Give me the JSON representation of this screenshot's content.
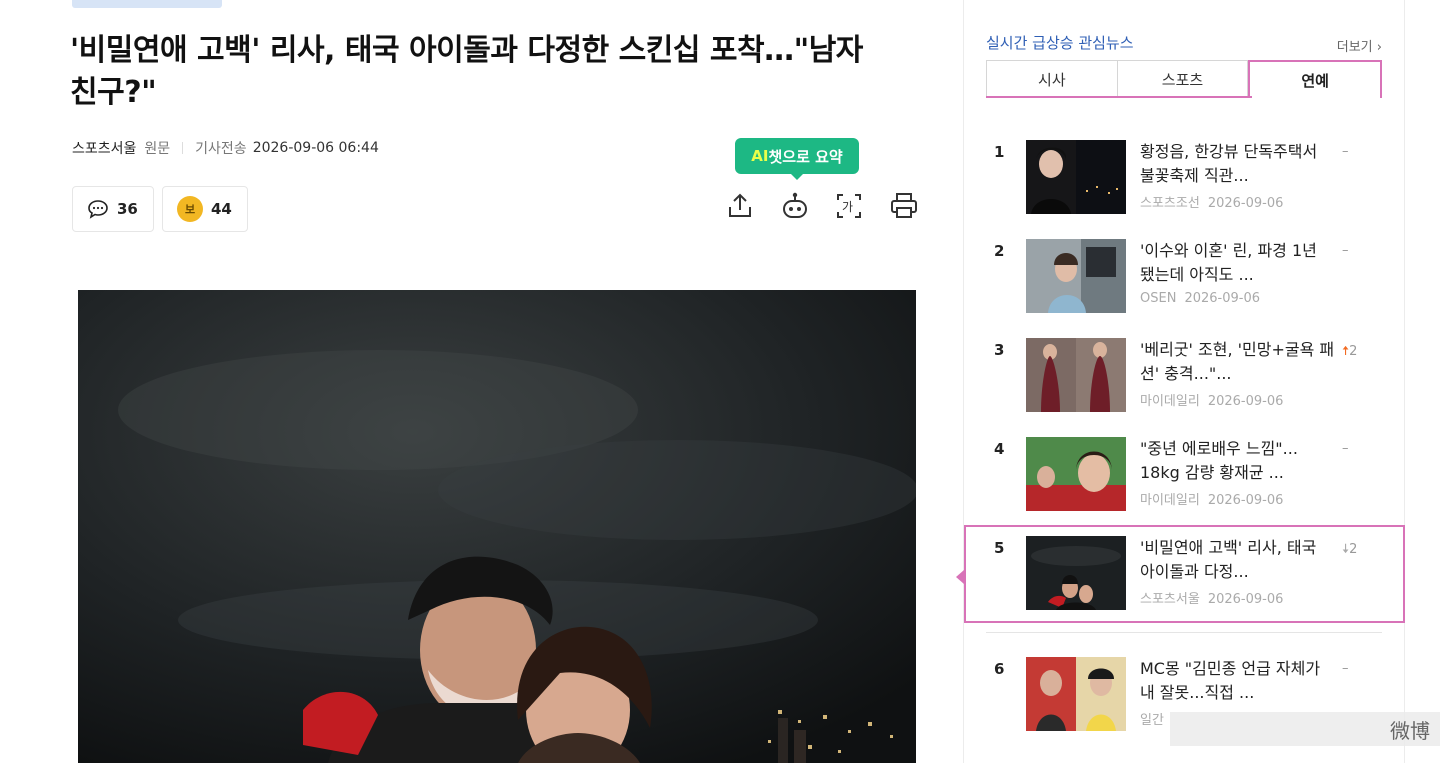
{
  "article": {
    "headline": "'비밀연애 고백' 리사, 태국 아이돌과 다정한 스킨십 포착…\"남자친구?\"",
    "source": "스포츠서울",
    "original_label": "원문",
    "sent_label": "기사전송",
    "datetime": "2026-09-06 06:44",
    "comment_count": "36",
    "reaction_count": "44",
    "reaction_badge": "보",
    "ai_tooltip_prefix": "AI",
    "ai_tooltip_suffix": "챗으로 요약",
    "font_button": "가"
  },
  "sidebar": {
    "title": "실시간 급상승 관심뉴스",
    "more": "더보기",
    "tabs": [
      {
        "label": "시사",
        "active": false
      },
      {
        "label": "스포츠",
        "active": false
      },
      {
        "label": "연예",
        "active": true
      }
    ],
    "items": [
      {
        "rank": "1",
        "title": "황정음, 한강뷰 단독주택서 불꽃축제 직관...",
        "source": "스포츠조선",
        "date": "2026-09-06",
        "change": "–"
      },
      {
        "rank": "2",
        "title": "'이수와 이혼' 린, 파경 1년 됐는데 아직도 ...",
        "source": "OSEN",
        "date": "2026-09-06",
        "change": "–"
      },
      {
        "rank": "3",
        "title": "'베리굿' 조현, '민망+굴욕 패션' 충격...\"...",
        "source": "마이데일리",
        "date": "2026-09-06",
        "change": "2",
        "direction": "up"
      },
      {
        "rank": "4",
        "title": "\"중년 에로배우 느낌\"... 18kg 감량 황재균 ...",
        "source": "마이데일리",
        "date": "2026-09-06",
        "change": "–"
      },
      {
        "rank": "5",
        "title": "'비밀연애 고백' 리사, 태국 아이돌과 다정...",
        "source": "스포츠서울",
        "date": "2026-09-06",
        "change": "2",
        "direction": "down"
      },
      {
        "rank": "6",
        "title": "MC몽 \"김민종 언급 자체가 내 잘못...직접 ...",
        "source": "일간",
        "date": "",
        "change": "–"
      }
    ]
  },
  "watermark": "微博"
}
